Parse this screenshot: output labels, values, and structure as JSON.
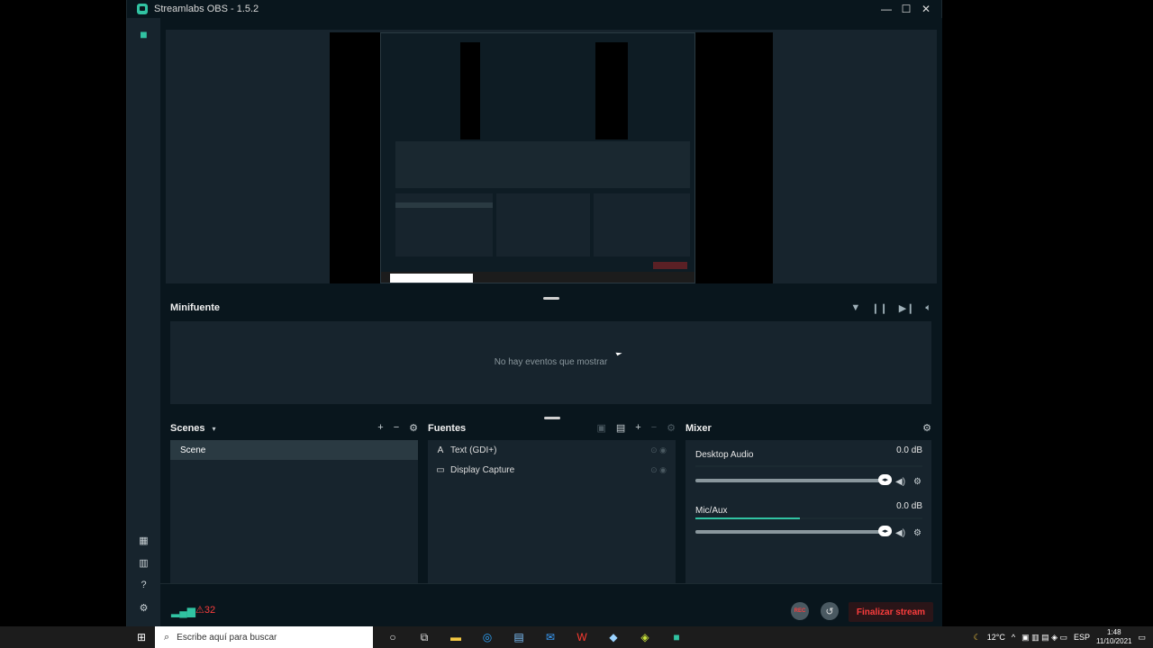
{
  "window": {
    "title": "Streamlabs OBS - 1.5.2",
    "minimize": "—",
    "maximize": "☐",
    "close": "✕"
  },
  "events": {
    "title": "Minifuente",
    "empty_text": "No hay eventos que mostrar"
  },
  "scenes": {
    "title": "Scenes",
    "items": [
      "Scene"
    ]
  },
  "sources": {
    "title": "Fuentes",
    "items": [
      {
        "label": "Text (GDI+)",
        "icon": "text-icon"
      },
      {
        "label": "Display Capture",
        "icon": "monitor-icon"
      }
    ]
  },
  "mixer": {
    "title": "Mixer",
    "channels": [
      {
        "name": "Desktop Audio",
        "db": "0.0 dB",
        "level": 0.0,
        "volume": 1.0
      },
      {
        "name": "Mic/Aux",
        "db": "0.0 dB",
        "level": 0.46,
        "volume": 1.0
      }
    ]
  },
  "footer": {
    "warnings": "32",
    "rec_label": "REC",
    "stream_button": "Finalizar stream"
  },
  "taskbar": {
    "search_placeholder": "Escribe aquí para buscar",
    "temperature": "12°C",
    "language": "ESP",
    "time": "1:48",
    "date": "11/10/2021"
  },
  "colors": {
    "accent": "#31c3a2",
    "danger": "#fc3d3d",
    "bg": "#09161d",
    "panel": "#17242d"
  }
}
